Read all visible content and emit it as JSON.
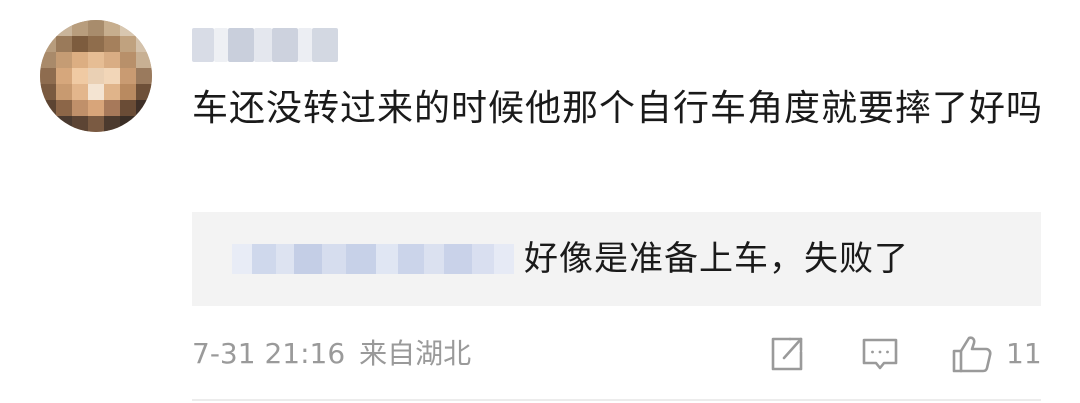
{
  "comment": {
    "text": "车还没转过来的时候他那个自行车角度就要摔了好吗",
    "date": "7-31 21:16",
    "location": "来自湖北",
    "like_count": "11"
  },
  "reply": {
    "text": "好像是准备上车，失败了"
  },
  "actions": {
    "repost_icon": "share-icon",
    "comment_icon": "comment-icon",
    "like_icon": "thumbs-up-icon"
  },
  "colors": {
    "meta_text": "#9a9a9a",
    "reply_bg": "#f3f3f3",
    "body_text": "#1a1a1a"
  }
}
